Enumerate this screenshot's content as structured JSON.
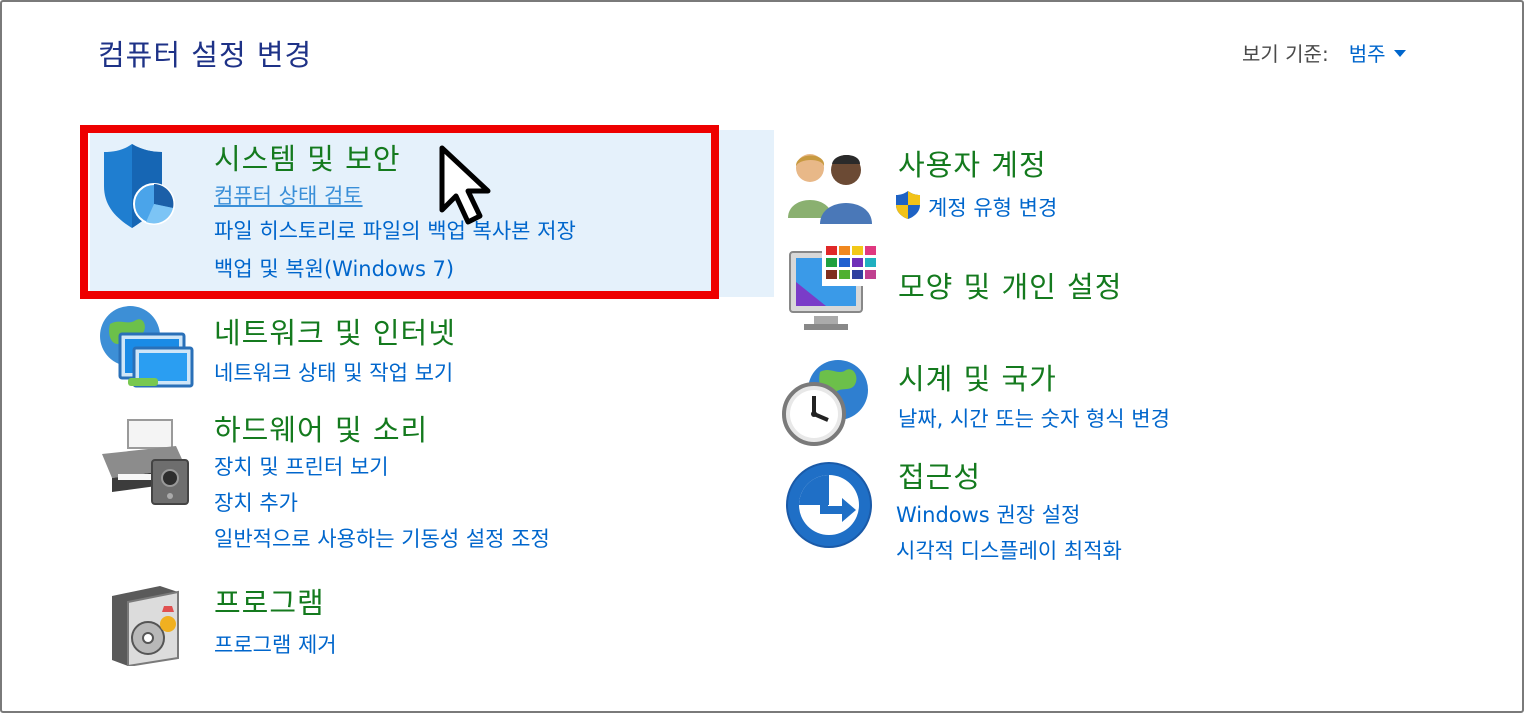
{
  "header": {
    "title": "컴퓨터 설정 변경",
    "view_by_label": "보기 기준:",
    "view_by_value": "범주"
  },
  "left": [
    {
      "title": "시스템 및 보안",
      "links": [
        "컴퓨터 상태 검토",
        "파일 히스토리로 파일의 백업 복사본 저장",
        "백업 및 복원(Windows 7)"
      ],
      "icon": "shield-icon"
    },
    {
      "title": "네트워크 및 인터넷",
      "links": [
        "네트워크 상태 및 작업 보기"
      ],
      "icon": "network-icon"
    },
    {
      "title": "하드웨어 및 소리",
      "links": [
        "장치 및 프린터 보기",
        "장치 추가",
        "일반적으로 사용하는 기동성 설정 조정"
      ],
      "icon": "printer-icon"
    },
    {
      "title": "프로그램",
      "links": [
        "프로그램 제거"
      ],
      "icon": "programs-icon"
    }
  ],
  "right": [
    {
      "title": "사용자 계정",
      "links": [
        "계정 유형 변경"
      ],
      "icon": "users-icon"
    },
    {
      "title": "모양 및 개인 설정",
      "links": [],
      "icon": "appearance-icon"
    },
    {
      "title": "시계 및 국가",
      "links": [
        "날짜, 시간 또는 숫자 형식 변경"
      ],
      "icon": "clock-globe-icon"
    },
    {
      "title": "접근성",
      "links": [
        "Windows 권장 설정",
        "시각적 디스플레이 최적화"
      ],
      "icon": "accessibility-icon"
    }
  ],
  "colors": {
    "title_green": "#147a1e",
    "link_blue": "#0066cc",
    "header_blue": "#1e3287",
    "highlight_red": "#ee0000",
    "hover_bg": "#e5f1fb"
  }
}
